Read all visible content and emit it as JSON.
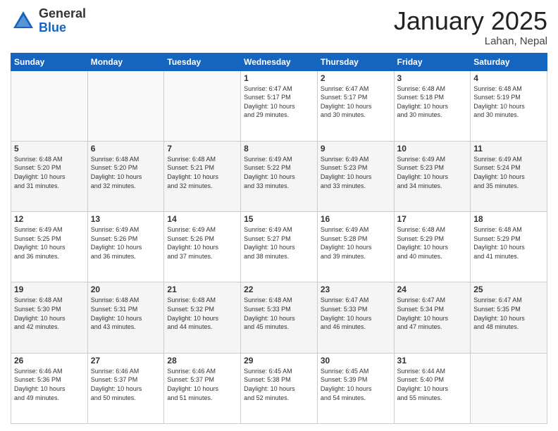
{
  "header": {
    "logo": {
      "general": "General",
      "blue": "Blue"
    },
    "title": "January 2025",
    "location": "Lahan, Nepal"
  },
  "weekdays": [
    "Sunday",
    "Monday",
    "Tuesday",
    "Wednesday",
    "Thursday",
    "Friday",
    "Saturday"
  ],
  "rows": [
    [
      {
        "day": "",
        "info": ""
      },
      {
        "day": "",
        "info": ""
      },
      {
        "day": "",
        "info": ""
      },
      {
        "day": "1",
        "info": "Sunrise: 6:47 AM\nSunset: 5:17 PM\nDaylight: 10 hours\nand 29 minutes."
      },
      {
        "day": "2",
        "info": "Sunrise: 6:47 AM\nSunset: 5:17 PM\nDaylight: 10 hours\nand 30 minutes."
      },
      {
        "day": "3",
        "info": "Sunrise: 6:48 AM\nSunset: 5:18 PM\nDaylight: 10 hours\nand 30 minutes."
      },
      {
        "day": "4",
        "info": "Sunrise: 6:48 AM\nSunset: 5:19 PM\nDaylight: 10 hours\nand 30 minutes."
      }
    ],
    [
      {
        "day": "5",
        "info": "Sunrise: 6:48 AM\nSunset: 5:20 PM\nDaylight: 10 hours\nand 31 minutes."
      },
      {
        "day": "6",
        "info": "Sunrise: 6:48 AM\nSunset: 5:20 PM\nDaylight: 10 hours\nand 32 minutes."
      },
      {
        "day": "7",
        "info": "Sunrise: 6:48 AM\nSunset: 5:21 PM\nDaylight: 10 hours\nand 32 minutes."
      },
      {
        "day": "8",
        "info": "Sunrise: 6:49 AM\nSunset: 5:22 PM\nDaylight: 10 hours\nand 33 minutes."
      },
      {
        "day": "9",
        "info": "Sunrise: 6:49 AM\nSunset: 5:23 PM\nDaylight: 10 hours\nand 33 minutes."
      },
      {
        "day": "10",
        "info": "Sunrise: 6:49 AM\nSunset: 5:23 PM\nDaylight: 10 hours\nand 34 minutes."
      },
      {
        "day": "11",
        "info": "Sunrise: 6:49 AM\nSunset: 5:24 PM\nDaylight: 10 hours\nand 35 minutes."
      }
    ],
    [
      {
        "day": "12",
        "info": "Sunrise: 6:49 AM\nSunset: 5:25 PM\nDaylight: 10 hours\nand 36 minutes."
      },
      {
        "day": "13",
        "info": "Sunrise: 6:49 AM\nSunset: 5:26 PM\nDaylight: 10 hours\nand 36 minutes."
      },
      {
        "day": "14",
        "info": "Sunrise: 6:49 AM\nSunset: 5:26 PM\nDaylight: 10 hours\nand 37 minutes."
      },
      {
        "day": "15",
        "info": "Sunrise: 6:49 AM\nSunset: 5:27 PM\nDaylight: 10 hours\nand 38 minutes."
      },
      {
        "day": "16",
        "info": "Sunrise: 6:49 AM\nSunset: 5:28 PM\nDaylight: 10 hours\nand 39 minutes."
      },
      {
        "day": "17",
        "info": "Sunrise: 6:48 AM\nSunset: 5:29 PM\nDaylight: 10 hours\nand 40 minutes."
      },
      {
        "day": "18",
        "info": "Sunrise: 6:48 AM\nSunset: 5:29 PM\nDaylight: 10 hours\nand 41 minutes."
      }
    ],
    [
      {
        "day": "19",
        "info": "Sunrise: 6:48 AM\nSunset: 5:30 PM\nDaylight: 10 hours\nand 42 minutes."
      },
      {
        "day": "20",
        "info": "Sunrise: 6:48 AM\nSunset: 5:31 PM\nDaylight: 10 hours\nand 43 minutes."
      },
      {
        "day": "21",
        "info": "Sunrise: 6:48 AM\nSunset: 5:32 PM\nDaylight: 10 hours\nand 44 minutes."
      },
      {
        "day": "22",
        "info": "Sunrise: 6:48 AM\nSunset: 5:33 PM\nDaylight: 10 hours\nand 45 minutes."
      },
      {
        "day": "23",
        "info": "Sunrise: 6:47 AM\nSunset: 5:33 PM\nDaylight: 10 hours\nand 46 minutes."
      },
      {
        "day": "24",
        "info": "Sunrise: 6:47 AM\nSunset: 5:34 PM\nDaylight: 10 hours\nand 47 minutes."
      },
      {
        "day": "25",
        "info": "Sunrise: 6:47 AM\nSunset: 5:35 PM\nDaylight: 10 hours\nand 48 minutes."
      }
    ],
    [
      {
        "day": "26",
        "info": "Sunrise: 6:46 AM\nSunset: 5:36 PM\nDaylight: 10 hours\nand 49 minutes."
      },
      {
        "day": "27",
        "info": "Sunrise: 6:46 AM\nSunset: 5:37 PM\nDaylight: 10 hours\nand 50 minutes."
      },
      {
        "day": "28",
        "info": "Sunrise: 6:46 AM\nSunset: 5:37 PM\nDaylight: 10 hours\nand 51 minutes."
      },
      {
        "day": "29",
        "info": "Sunrise: 6:45 AM\nSunset: 5:38 PM\nDaylight: 10 hours\nand 52 minutes."
      },
      {
        "day": "30",
        "info": "Sunrise: 6:45 AM\nSunset: 5:39 PM\nDaylight: 10 hours\nand 54 minutes."
      },
      {
        "day": "31",
        "info": "Sunrise: 6:44 AM\nSunset: 5:40 PM\nDaylight: 10 hours\nand 55 minutes."
      },
      {
        "day": "",
        "info": ""
      }
    ]
  ]
}
